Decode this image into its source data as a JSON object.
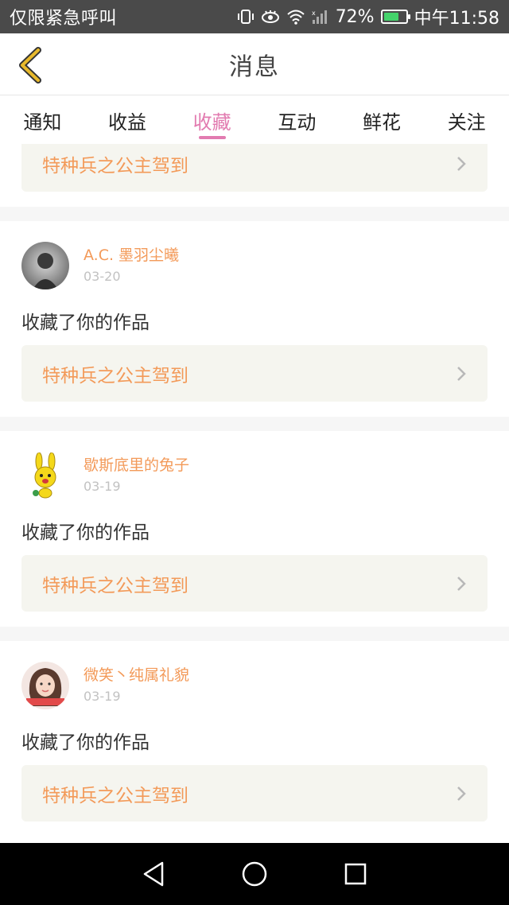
{
  "status_bar": {
    "left_text": "仅限紧急呼叫",
    "battery_percent": "72%",
    "time": "中午11:58",
    "icons": [
      "vibrate-icon",
      "eye-icon",
      "wifi-icon",
      "signal-icon",
      "battery-icon"
    ],
    "battery_color": "#44d36b"
  },
  "header": {
    "title": "消息",
    "back_icon": "chevron-left-icon",
    "back_color": "#e8b92b"
  },
  "tabs": [
    {
      "label": "通知",
      "active": false
    },
    {
      "label": "收益",
      "active": false
    },
    {
      "label": "收藏",
      "active": true
    },
    {
      "label": "互动",
      "active": false
    },
    {
      "label": "鲜花",
      "active": false
    },
    {
      "label": "关注",
      "active": false
    }
  ],
  "accent_color": "#e27bb0",
  "link_color": "#f39a59",
  "partial_card": {
    "work_title": "特种兵之公主驾到"
  },
  "cards": [
    {
      "username": "A.C. 墨羽尘曦",
      "date": "03-20",
      "action": "收藏了你的作品",
      "work_title": "特种兵之公主驾到",
      "avatar": "avatar-grey-portrait"
    },
    {
      "username": "歇斯底里的兔子",
      "date": "03-19",
      "action": "收藏了你的作品",
      "work_title": "特种兵之公主驾到",
      "avatar": "avatar-yellow-bunny"
    },
    {
      "username": "微笑丶纯属礼貌",
      "date": "03-19",
      "action": "收藏了你的作品",
      "work_title": "特种兵之公主驾到",
      "avatar": "avatar-girl-portrait"
    }
  ],
  "nav_bar": {
    "icons": [
      "back-triangle-icon",
      "home-circle-icon",
      "recents-square-icon"
    ]
  }
}
